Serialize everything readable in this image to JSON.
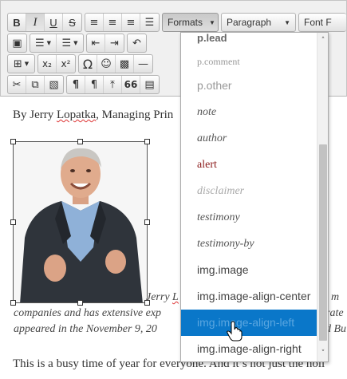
{
  "toolbar": {
    "formats_label": "Formats",
    "paragraph_label": "Paragraph",
    "font_label": "Font F",
    "bold_glyph": "B",
    "italic_glyph": "I",
    "underline_glyph": "U",
    "strike_glyph": "S",
    "subscript_glyph": "x₂",
    "superscript_glyph": "x²",
    "omega_glyph": "Ω",
    "pilcrow_glyph": "¶",
    "quote_glyph": "66"
  },
  "content": {
    "byline_prefix": "By Jerry ",
    "byline_misspelled": "Lopatka",
    "byline_suffix": ", Managing Prin",
    "caption_pre": "Jerry ",
    "caption_misspelled": "L",
    "caption_tail": "'s m",
    "line2": "companies and has extensive exp",
    "line2_tail": "rate",
    "line3": "appeared in the November 9, 20",
    "line3_tail": "d Bu",
    "paragraph": "This is a busy time of year for everyone. And it’s not just the holi"
  },
  "formats_menu": {
    "items": [
      {
        "label": "p.lead"
      },
      {
        "label": "p.comment"
      },
      {
        "label": "p.other"
      },
      {
        "label": "note"
      },
      {
        "label": "author"
      },
      {
        "label": "alert"
      },
      {
        "label": "disclaimer"
      },
      {
        "label": "testimony"
      },
      {
        "label": "testimony-by"
      },
      {
        "label": "img.image"
      },
      {
        "label": "img.image-align-center"
      },
      {
        "label": "img.image-align-left"
      },
      {
        "label": "img.image-align-right"
      }
    ],
    "selected_index": 11,
    "selected_color": "#0a77c9"
  }
}
